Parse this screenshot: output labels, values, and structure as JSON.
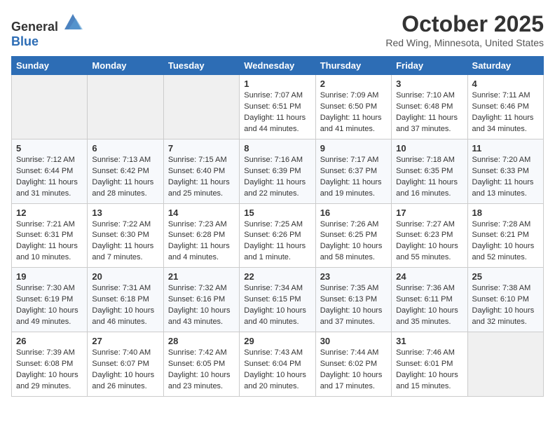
{
  "header": {
    "logo_general": "General",
    "logo_blue": "Blue",
    "month": "October 2025",
    "location": "Red Wing, Minnesota, United States"
  },
  "days_of_week": [
    "Sunday",
    "Monday",
    "Tuesday",
    "Wednesday",
    "Thursday",
    "Friday",
    "Saturday"
  ],
  "weeks": [
    [
      {
        "day": "",
        "info": ""
      },
      {
        "day": "",
        "info": ""
      },
      {
        "day": "",
        "info": ""
      },
      {
        "day": "1",
        "info": "Sunrise: 7:07 AM\nSunset: 6:51 PM\nDaylight: 11 hours and 44 minutes."
      },
      {
        "day": "2",
        "info": "Sunrise: 7:09 AM\nSunset: 6:50 PM\nDaylight: 11 hours and 41 minutes."
      },
      {
        "day": "3",
        "info": "Sunrise: 7:10 AM\nSunset: 6:48 PM\nDaylight: 11 hours and 37 minutes."
      },
      {
        "day": "4",
        "info": "Sunrise: 7:11 AM\nSunset: 6:46 PM\nDaylight: 11 hours and 34 minutes."
      }
    ],
    [
      {
        "day": "5",
        "info": "Sunrise: 7:12 AM\nSunset: 6:44 PM\nDaylight: 11 hours and 31 minutes."
      },
      {
        "day": "6",
        "info": "Sunrise: 7:13 AM\nSunset: 6:42 PM\nDaylight: 11 hours and 28 minutes."
      },
      {
        "day": "7",
        "info": "Sunrise: 7:15 AM\nSunset: 6:40 PM\nDaylight: 11 hours and 25 minutes."
      },
      {
        "day": "8",
        "info": "Sunrise: 7:16 AM\nSunset: 6:39 PM\nDaylight: 11 hours and 22 minutes."
      },
      {
        "day": "9",
        "info": "Sunrise: 7:17 AM\nSunset: 6:37 PM\nDaylight: 11 hours and 19 minutes."
      },
      {
        "day": "10",
        "info": "Sunrise: 7:18 AM\nSunset: 6:35 PM\nDaylight: 11 hours and 16 minutes."
      },
      {
        "day": "11",
        "info": "Sunrise: 7:20 AM\nSunset: 6:33 PM\nDaylight: 11 hours and 13 minutes."
      }
    ],
    [
      {
        "day": "12",
        "info": "Sunrise: 7:21 AM\nSunset: 6:31 PM\nDaylight: 11 hours and 10 minutes."
      },
      {
        "day": "13",
        "info": "Sunrise: 7:22 AM\nSunset: 6:30 PM\nDaylight: 11 hours and 7 minutes."
      },
      {
        "day": "14",
        "info": "Sunrise: 7:23 AM\nSunset: 6:28 PM\nDaylight: 11 hours and 4 minutes."
      },
      {
        "day": "15",
        "info": "Sunrise: 7:25 AM\nSunset: 6:26 PM\nDaylight: 11 hours and 1 minute."
      },
      {
        "day": "16",
        "info": "Sunrise: 7:26 AM\nSunset: 6:25 PM\nDaylight: 10 hours and 58 minutes."
      },
      {
        "day": "17",
        "info": "Sunrise: 7:27 AM\nSunset: 6:23 PM\nDaylight: 10 hours and 55 minutes."
      },
      {
        "day": "18",
        "info": "Sunrise: 7:28 AM\nSunset: 6:21 PM\nDaylight: 10 hours and 52 minutes."
      }
    ],
    [
      {
        "day": "19",
        "info": "Sunrise: 7:30 AM\nSunset: 6:19 PM\nDaylight: 10 hours and 49 minutes."
      },
      {
        "day": "20",
        "info": "Sunrise: 7:31 AM\nSunset: 6:18 PM\nDaylight: 10 hours and 46 minutes."
      },
      {
        "day": "21",
        "info": "Sunrise: 7:32 AM\nSunset: 6:16 PM\nDaylight: 10 hours and 43 minutes."
      },
      {
        "day": "22",
        "info": "Sunrise: 7:34 AM\nSunset: 6:15 PM\nDaylight: 10 hours and 40 minutes."
      },
      {
        "day": "23",
        "info": "Sunrise: 7:35 AM\nSunset: 6:13 PM\nDaylight: 10 hours and 37 minutes."
      },
      {
        "day": "24",
        "info": "Sunrise: 7:36 AM\nSunset: 6:11 PM\nDaylight: 10 hours and 35 minutes."
      },
      {
        "day": "25",
        "info": "Sunrise: 7:38 AM\nSunset: 6:10 PM\nDaylight: 10 hours and 32 minutes."
      }
    ],
    [
      {
        "day": "26",
        "info": "Sunrise: 7:39 AM\nSunset: 6:08 PM\nDaylight: 10 hours and 29 minutes."
      },
      {
        "day": "27",
        "info": "Sunrise: 7:40 AM\nSunset: 6:07 PM\nDaylight: 10 hours and 26 minutes."
      },
      {
        "day": "28",
        "info": "Sunrise: 7:42 AM\nSunset: 6:05 PM\nDaylight: 10 hours and 23 minutes."
      },
      {
        "day": "29",
        "info": "Sunrise: 7:43 AM\nSunset: 6:04 PM\nDaylight: 10 hours and 20 minutes."
      },
      {
        "day": "30",
        "info": "Sunrise: 7:44 AM\nSunset: 6:02 PM\nDaylight: 10 hours and 17 minutes."
      },
      {
        "day": "31",
        "info": "Sunrise: 7:46 AM\nSunset: 6:01 PM\nDaylight: 10 hours and 15 minutes."
      },
      {
        "day": "",
        "info": ""
      }
    ]
  ]
}
